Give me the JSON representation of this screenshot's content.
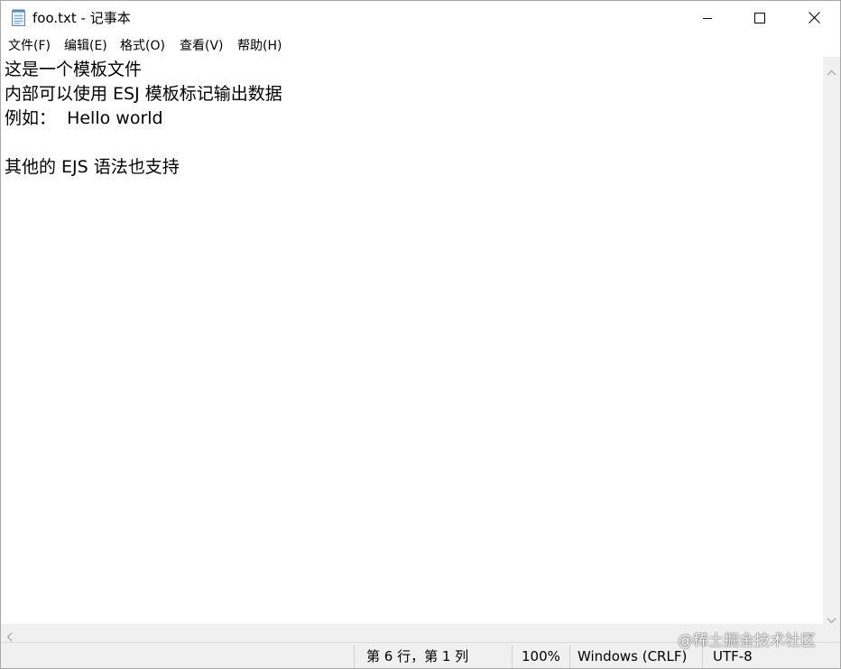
{
  "window": {
    "title": "foo.txt - 记事本"
  },
  "menu": {
    "items": [
      {
        "label": "文件(F)"
      },
      {
        "label": "编辑(E)"
      },
      {
        "label": "格式(O)"
      },
      {
        "label": "查看(V)"
      },
      {
        "label": "帮助(H)"
      }
    ]
  },
  "editor": {
    "lines": [
      "这是一个模板文件",
      "内部可以使用 ESJ 模板标记输出数据",
      "例如：  Hello world",
      "",
      "其他的 EJS 语法也支持"
    ]
  },
  "statusbar": {
    "position": "第 6 行，第 1 列",
    "zoom": "100%",
    "line_ending": "Windows (CRLF)",
    "encoding": "UTF-8"
  },
  "watermark": "@稀土掘金技术社区",
  "icons": {
    "app": "notepad-icon",
    "minimize": "minimize-icon",
    "maximize": "maximize-icon",
    "close": "close-icon"
  }
}
